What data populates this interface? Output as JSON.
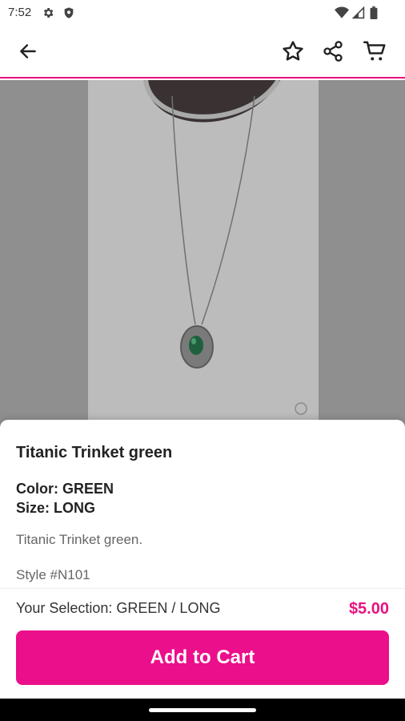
{
  "status_bar": {
    "time": "7:52",
    "icons": [
      "gear-icon",
      "shield-icon",
      "wifi-icon",
      "signal-icon",
      "battery-icon"
    ]
  },
  "app_bar": {
    "back_icon": "back-arrow-icon",
    "actions": [
      "star-icon",
      "share-icon",
      "cart-icon"
    ],
    "accent_color": "#e8127f"
  },
  "product": {
    "title": "Titanic Trinket green",
    "color_line": "Color: GREEN",
    "size_line": "Size: LONG",
    "description": "Titanic Trinket green.",
    "style": "Style #N101",
    "selection": "Your Selection: GREEN / LONG",
    "price": "$5.00"
  },
  "actions": {
    "add_to_cart_label": "Add to Cart",
    "button_color": "#eb0f8b"
  }
}
